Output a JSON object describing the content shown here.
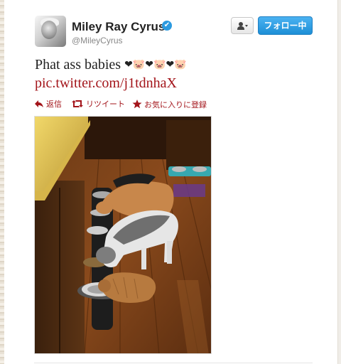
{
  "header": {
    "display_name": "Miley Ray Cyrus",
    "username": "@MileyCyrus",
    "verified": true,
    "verified_badge": "✔",
    "user_menu_icon": "user-dropdown-icon",
    "follow_button_label": "フォロー中"
  },
  "tweet": {
    "text": "Phat ass babies",
    "emoji": [
      "❤",
      "🐷",
      "❤",
      "🐷",
      "❤",
      "🐷"
    ],
    "link_text": "pic.twitter.com/j1tdnhaX"
  },
  "actions": [
    {
      "label": "返信",
      "icon": "reply-arrow-icon"
    },
    {
      "label": "リツイート",
      "icon": "retweet-icon"
    },
    {
      "label": "お気に入りに登録",
      "icon": "star-icon"
    }
  ],
  "media": {
    "description_icon": "photo"
  },
  "colors": {
    "link": "#a3141a",
    "follow_button": "#2b9ae0",
    "verified": "#2b9ae0"
  }
}
